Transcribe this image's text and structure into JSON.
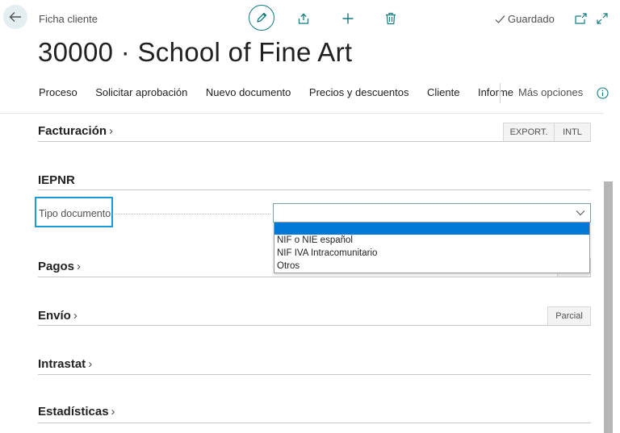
{
  "header": {
    "breadcrumb": "Ficha cliente",
    "status": "Guardado"
  },
  "page": {
    "title": "30000 · School of Fine Art"
  },
  "actions": {
    "items": [
      "Proceso",
      "Solicitar aprobación",
      "Nuevo documento",
      "Precios y descuentos",
      "Cliente",
      "Informe"
    ],
    "more": "Más opciones"
  },
  "sections": {
    "facturacion": {
      "title": "Facturación",
      "chips": [
        "EXPORT.",
        "INTL"
      ]
    },
    "iepnr": {
      "title": "IEPNR"
    },
    "pagos": {
      "title": "Pagos"
    },
    "envio": {
      "title": "Envío",
      "chip": "Parcial"
    },
    "intrastat": {
      "title": "Intrastat"
    },
    "estadisticas": {
      "title": "Estadísticas"
    }
  },
  "field": {
    "label": "Tipo documento",
    "value": "",
    "options": [
      "",
      "NIF o NIE español",
      "NIF IVA Intracomunitario",
      "Otros"
    ]
  },
  "colors": {
    "accent": "#0f7b7f",
    "focus": "#1e9ad6",
    "selection": "#0078d7"
  }
}
